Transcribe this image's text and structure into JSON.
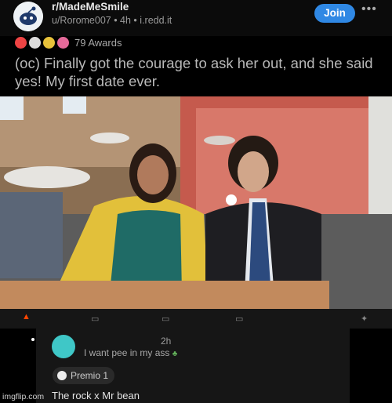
{
  "post": {
    "subreddit": "r/MadeMeSmile",
    "meta": "u/Rorome007 • 4h • i.redd.it",
    "join_label": "Join",
    "more_icon": "more-horizontal-icon",
    "awards_text": "79 Awards",
    "title": "(oc) Finally got the courage to ask her out, and she said yes! My first date ever."
  },
  "comment": {
    "time": "2h",
    "username": "I want pee in my ass",
    "award_label": "Premio 1",
    "text": "The rock x Mr bean"
  },
  "footer": {
    "watermark": "imgflip.com"
  },
  "colors": {
    "join": "#2f88e4",
    "background": "#000000",
    "panel": "#161616"
  }
}
